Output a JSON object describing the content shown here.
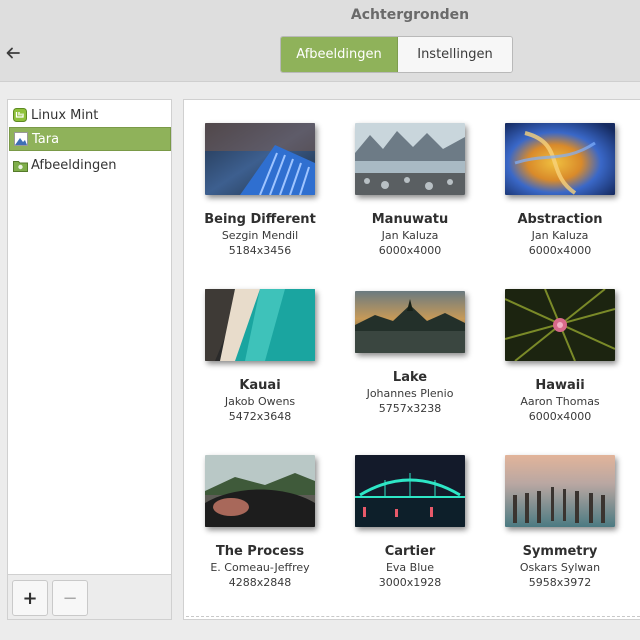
{
  "window": {
    "title": "Achtergronden"
  },
  "tabs": [
    {
      "label": "Afbeeldingen",
      "active": true
    },
    {
      "label": "Instellingen",
      "active": false
    }
  ],
  "sidebar": {
    "items": [
      {
        "label": "Linux Mint",
        "icon": "mint-logo-icon",
        "selected": false
      },
      {
        "label": "Tara",
        "icon": "image-file-icon",
        "selected": true
      },
      {
        "label": "Afbeeldingen",
        "icon": "pictures-folder-icon",
        "selected": false
      }
    ],
    "add_label": "+",
    "remove_label": "−"
  },
  "wallpapers": [
    {
      "name": "Being Different",
      "author": "Sezgin Mendil",
      "size": "5184x3456"
    },
    {
      "name": "Manuwatu",
      "author": "Jan Kaluza",
      "size": "6000x4000"
    },
    {
      "name": "Abstraction",
      "author": "Jan Kaluza",
      "size": "6000x4000"
    },
    {
      "name": "Kauai",
      "author": "Jakob Owens",
      "size": "5472x3648"
    },
    {
      "name": "Lake",
      "author": "Johannes Plenio",
      "size": "5757x3238"
    },
    {
      "name": "Hawaii",
      "author": "Aaron Thomas",
      "size": "6000x4000"
    },
    {
      "name": "The Process",
      "author": "E. Comeau-Jeffrey",
      "size": "4288x2848"
    },
    {
      "name": "Cartier",
      "author": "Eva Blue",
      "size": "3000x1928"
    },
    {
      "name": "Symmetry",
      "author": "Oskars Sylwan",
      "size": "5958x3972"
    }
  ],
  "colors": {
    "accent": "#8fb25a"
  }
}
